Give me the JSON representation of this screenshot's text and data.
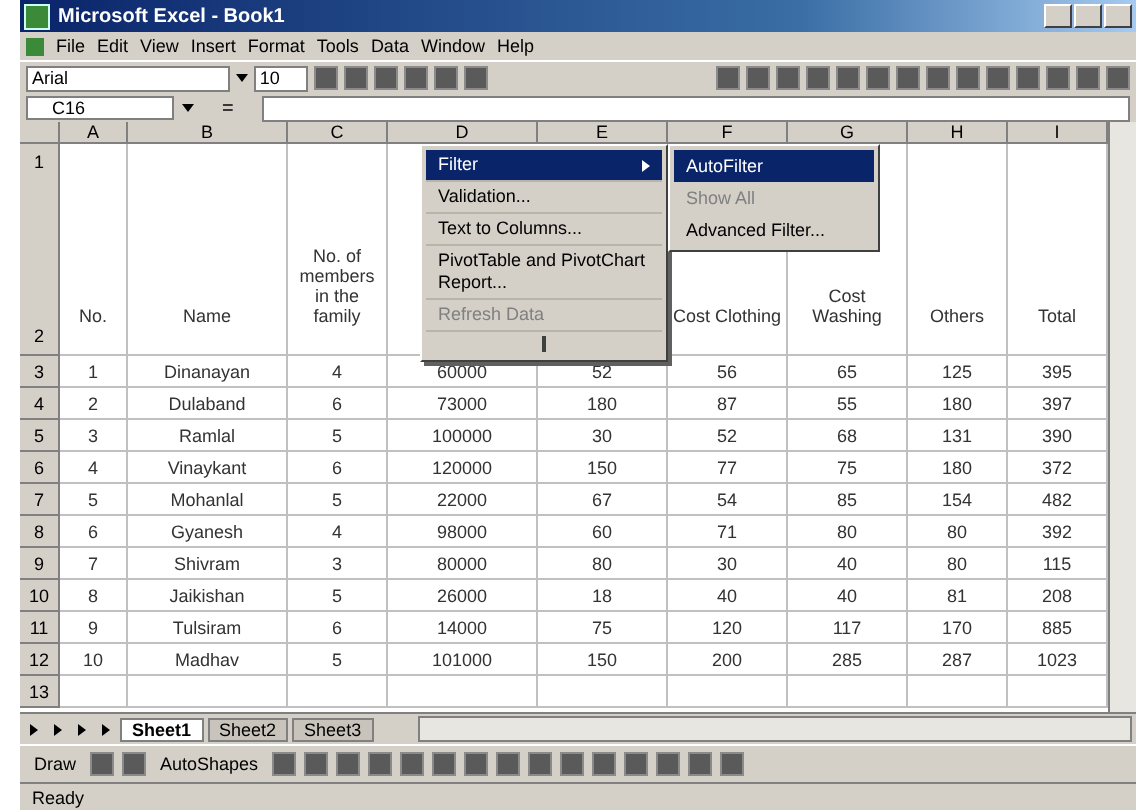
{
  "window": {
    "title": "Microsoft Excel - Book1"
  },
  "menu_bar": [
    "File",
    "Edit",
    "View",
    "Insert",
    "Format",
    "Tools",
    "Data",
    "Window",
    "Help"
  ],
  "formatting": {
    "font": "Arial",
    "size": "10"
  },
  "formula_bar": {
    "name_box": "C16",
    "equals": "="
  },
  "sheet": {
    "columns": [
      {
        "letter": "A",
        "heading": "No."
      },
      {
        "letter": "B",
        "heading": "Name"
      },
      {
        "letter": "C",
        "heading": "No. of members in the family"
      },
      {
        "letter": "D"
      },
      {
        "letter": "E"
      },
      {
        "letter": "F",
        "heading": "Cost Clothing"
      },
      {
        "letter": "G",
        "heading": "Cost Washing"
      },
      {
        "letter": "H",
        "heading": "Others"
      },
      {
        "letter": "I",
        "heading": "Total"
      }
    ],
    "header_rows": [
      "1",
      "2"
    ],
    "rows": [
      {
        "num": "3",
        "cells": [
          "1",
          "Dinanayan",
          "4",
          "60000",
          "52",
          "56",
          "65",
          "125",
          "395"
        ]
      },
      {
        "num": "4",
        "cells": [
          "2",
          "Dulaband",
          "6",
          "73000",
          "180",
          "87",
          "55",
          "180",
          "397"
        ]
      },
      {
        "num": "5",
        "cells": [
          "3",
          "Ramlal",
          "5",
          "100000",
          "30",
          "52",
          "68",
          "131",
          "390"
        ]
      },
      {
        "num": "6",
        "cells": [
          "4",
          "Vinaykant",
          "6",
          "120000",
          "150",
          "77",
          "75",
          "180",
          "372"
        ]
      },
      {
        "num": "7",
        "cells": [
          "5",
          "Mohanlal",
          "5",
          "22000",
          "67",
          "54",
          "85",
          "154",
          "482"
        ]
      },
      {
        "num": "8",
        "cells": [
          "6",
          "Gyanesh",
          "4",
          "98000",
          "60",
          "71",
          "80",
          "80",
          "392"
        ]
      },
      {
        "num": "9",
        "cells": [
          "7",
          "Shivram",
          "3",
          "80000",
          "80",
          "30",
          "40",
          "80",
          "115"
        ]
      },
      {
        "num": "10",
        "cells": [
          "8",
          "Jaikishan",
          "5",
          "26000",
          "18",
          "40",
          "40",
          "81",
          "208"
        ]
      },
      {
        "num": "11",
        "cells": [
          "9",
          "Tulsiram",
          "6",
          "14000",
          "75",
          "120",
          "117",
          "170",
          "885"
        ]
      },
      {
        "num": "12",
        "cells": [
          "10",
          "Madhav",
          "5",
          "101000",
          "150",
          "200",
          "285",
          "287",
          "1023"
        ]
      }
    ],
    "last_row": "13"
  },
  "data_menu": {
    "items": [
      {
        "label": "Filter",
        "kind": "submenu",
        "selected": true,
        "disabled": false
      },
      {
        "label": "Validation...",
        "kind": "plain",
        "selected": false,
        "disabled": false
      },
      {
        "label": "Text to Columns...",
        "kind": "plain",
        "selected": false,
        "disabled": false
      },
      {
        "label": "PivotTable and PivotChart Report...",
        "kind": "plain",
        "selected": false,
        "disabled": false
      },
      {
        "label": "Refresh Data",
        "kind": "plain",
        "selected": false,
        "disabled": true
      }
    ]
  },
  "filter_submenu": {
    "items": [
      {
        "label": "AutoFilter",
        "selected": true,
        "disabled": false
      },
      {
        "label": "Show All",
        "selected": false,
        "disabled": true
      },
      {
        "label": "Advanced Filter...",
        "selected": false,
        "disabled": false
      }
    ]
  },
  "sheet_tabs": [
    {
      "label": "Sheet1",
      "selected": true
    },
    {
      "label": "Sheet2",
      "selected": false
    },
    {
      "label": "Sheet3",
      "selected": false
    }
  ],
  "drawing_toolbar": {
    "draw": "Draw",
    "autoshapes": "AutoShapes"
  },
  "status_bar": "Ready"
}
